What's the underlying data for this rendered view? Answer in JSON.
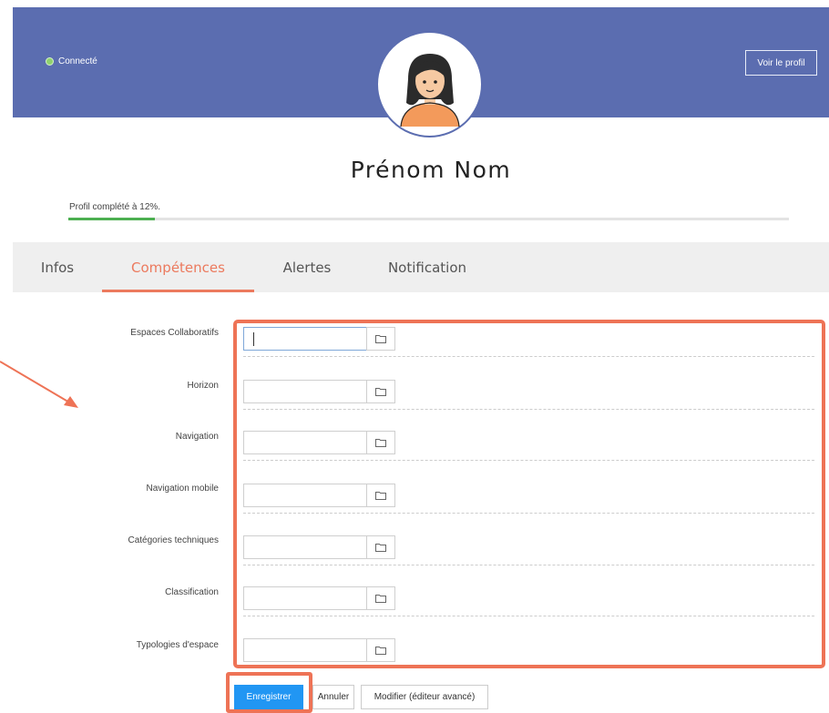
{
  "header": {
    "status_label": "Connecté",
    "view_profile_label": "Voir le profil",
    "background_color": "#5b6db0",
    "status_color": "#8fd16e"
  },
  "user": {
    "name": "Prénom Nom",
    "avatar_icon": "user-avatar-icon"
  },
  "profile": {
    "completion_label": "Profil complété à 12%.",
    "completion_percent": 12
  },
  "tabs": [
    {
      "label": "Infos",
      "active": false
    },
    {
      "label": "Compétences",
      "active": true
    },
    {
      "label": "Alertes",
      "active": false
    },
    {
      "label": "Notification",
      "active": false
    }
  ],
  "form": {
    "fields": [
      {
        "label": "Espaces Collaboratifs",
        "value": ""
      },
      {
        "label": "Horizon",
        "value": ""
      },
      {
        "label": "Navigation",
        "value": ""
      },
      {
        "label": "Navigation mobile",
        "value": ""
      },
      {
        "label": "Catégories techniques",
        "value": ""
      },
      {
        "label": "Classification",
        "value": ""
      },
      {
        "label": "Typologies d'espace",
        "value": ""
      }
    ],
    "browse_icon": "folder-icon"
  },
  "actions": {
    "save_label": "Enregistrer",
    "cancel_label": "Annuler",
    "advanced_label": "Modifier (éditeur avancé)"
  },
  "annotation": {
    "highlight_color": "#ee7356"
  }
}
